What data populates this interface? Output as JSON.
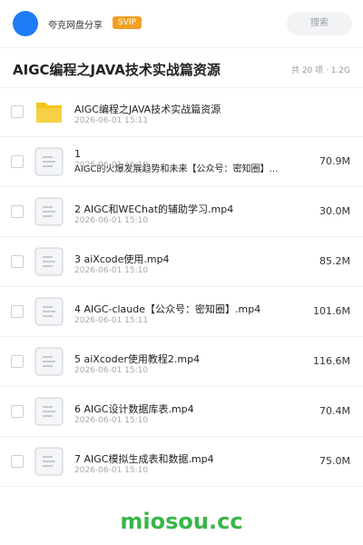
{
  "header": {
    "app_name": "夸克网盘分享",
    "badge": "SVIP",
    "search_placeholder": "搜索"
  },
  "title": "AIGC编程之JAVA技术实战篇资源",
  "meta": "共 20 项 · 1.2G",
  "items": [
    {
      "type": "folder",
      "name": "AIGC编程之JAVA技术实战篇资源",
      "name2": "",
      "date": "2026-06-01 15:11",
      "size": ""
    },
    {
      "type": "file",
      "name": "1",
      "name2": "AIGC的火爆发展趋势和未来【公众号：密知圈】…",
      "date": "2026-06-01 15:10",
      "size": "70.9M"
    },
    {
      "type": "file",
      "name": "2 AIGC和WEChat的辅助学习.mp4",
      "name2": "",
      "date": "2026-06-01 15:10",
      "size": "30.0M"
    },
    {
      "type": "file",
      "name": "3 aiXcode使用.mp4",
      "name2": "",
      "date": "2026-06-01 15:10",
      "size": "85.2M"
    },
    {
      "type": "file",
      "name": "4 AIGC-claude【公众号：密知圈】.mp4",
      "name2": "",
      "date": "2026-06-01 15:11",
      "size": "101.6M"
    },
    {
      "type": "file",
      "name": "5 aiXcoder使用教程2.mp4",
      "name2": "",
      "date": "2026-06-01 15:10",
      "size": "116.6M"
    },
    {
      "type": "file",
      "name": "6 AIGC设计数据库表.mp4",
      "name2": "",
      "date": "2026-06-01 15:10",
      "size": "70.4M"
    },
    {
      "type": "file",
      "name": "7 AIGC模拟生成表和数据.mp4",
      "name2": "",
      "date": "2026-06-01 15:10",
      "size": "75.0M"
    }
  ],
  "footer": "miosou.cc",
  "colors": {
    "accent": "#1e7bf6",
    "svip": "#f2a024",
    "folder": "#f5c518",
    "footer": "#39b54a"
  }
}
